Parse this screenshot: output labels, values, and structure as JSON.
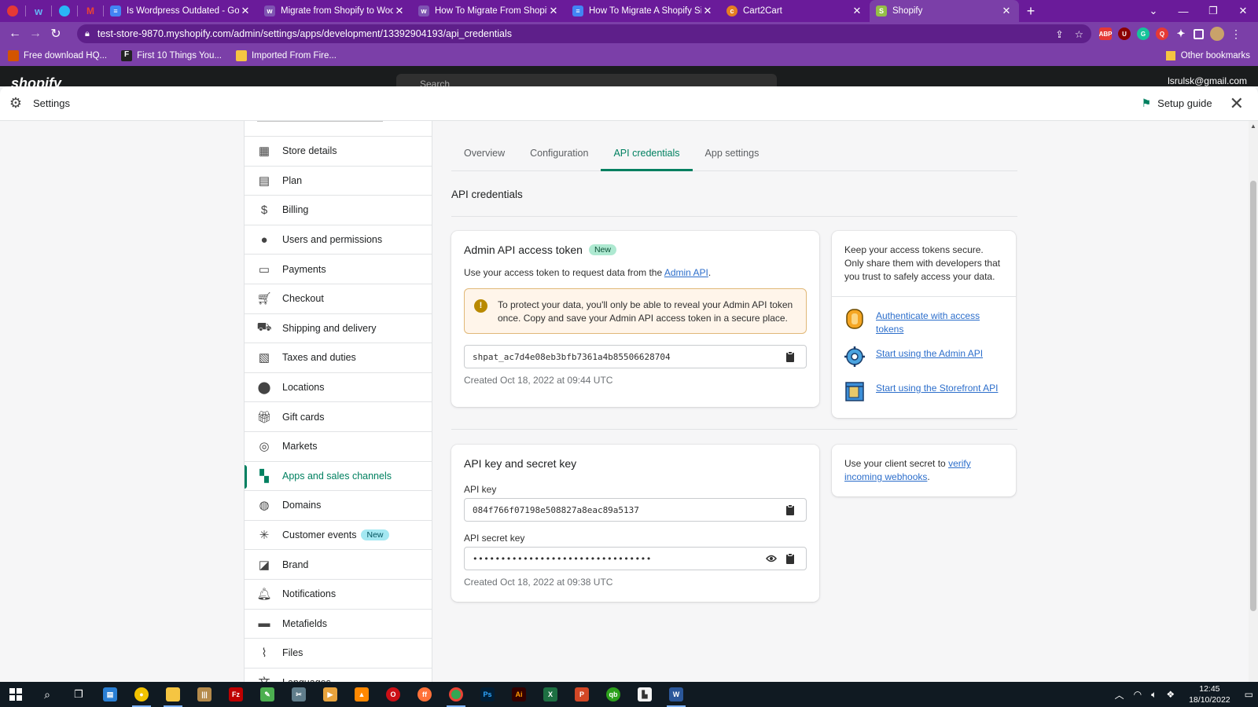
{
  "browser": {
    "tabs": [
      {
        "title": "",
        "icon": "search-icon",
        "color": "#e53935"
      },
      {
        "title": "",
        "icon": "wordpress-icon",
        "color": "#1e88e5"
      },
      {
        "title": "",
        "icon": "globe-icon",
        "color": "#29b6f6"
      },
      {
        "title": "",
        "icon": "gmail-icon",
        "color": "#ea4335"
      },
      {
        "title": "Is Wordpress Outdated - Google",
        "icon": "docs-icon",
        "color": "#4285f4"
      },
      {
        "title": "Migrate from Shopify to WooCon",
        "icon": "woo-icon",
        "color": "#7f54b3"
      },
      {
        "title": "How To Migrate From Shopify To",
        "icon": "woo-icon",
        "color": "#7f54b3"
      },
      {
        "title": "How To Migrate A Shopify Site To",
        "icon": "docs-icon",
        "color": "#4285f4"
      },
      {
        "title": "Cart2Cart",
        "icon": "cart2cart-icon",
        "color": "#e67e22"
      },
      {
        "title": "Shopify",
        "icon": "shopify-icon",
        "color": "#95bf47"
      }
    ],
    "url": "test-store-9870.myshopify.com/admin/settings/apps/development/13392904193/api_credentials",
    "bookmarks": [
      "Free download HQ...",
      "First 10 Things You...",
      "Imported From Fire..."
    ],
    "other_bookmarks": "Other bookmarks"
  },
  "admin": {
    "logo": "shopify",
    "search_placeholder": "Search",
    "account": "lsrulsk@gmail.com"
  },
  "settings": {
    "title": "Settings",
    "setup_guide": "Setup guide"
  },
  "sidebar": {
    "items": [
      {
        "label": "Store details",
        "icon": "store-icon"
      },
      {
        "label": "Plan",
        "icon": "plan-icon"
      },
      {
        "label": "Billing",
        "icon": "billing-icon"
      },
      {
        "label": "Users and permissions",
        "icon": "user-icon"
      },
      {
        "label": "Payments",
        "icon": "payments-icon"
      },
      {
        "label": "Checkout",
        "icon": "cart-icon"
      },
      {
        "label": "Shipping and delivery",
        "icon": "truck-icon"
      },
      {
        "label": "Taxes and duties",
        "icon": "taxes-icon"
      },
      {
        "label": "Locations",
        "icon": "location-pin-icon"
      },
      {
        "label": "Gift cards",
        "icon": "gift-icon"
      },
      {
        "label": "Markets",
        "icon": "markets-icon"
      },
      {
        "label": "Apps and sales channels",
        "icon": "apps-icon"
      },
      {
        "label": "Domains",
        "icon": "globe-icon"
      },
      {
        "label": "Customer events",
        "icon": "cursor-icon",
        "badge": "New"
      },
      {
        "label": "Brand",
        "icon": "brand-icon"
      },
      {
        "label": "Notifications",
        "icon": "bell-icon"
      },
      {
        "label": "Metafields",
        "icon": "metafields-icon"
      },
      {
        "label": "Files",
        "icon": "paperclip-icon"
      },
      {
        "label": "Languages",
        "icon": "language-icon"
      }
    ],
    "active_index": 11
  },
  "tabs": [
    "Overview",
    "Configuration",
    "API credentials",
    "App settings"
  ],
  "active_tab": 2,
  "page_heading": "API credentials",
  "admin_token_card": {
    "title": "Admin API access token",
    "badge": "New",
    "desc_prefix": "Use your access token to request data from the ",
    "desc_link": "Admin API",
    "desc_suffix": ".",
    "banner": "To protect your data, you'll only be able to reveal your Admin API token once. Copy and save your Admin API access token in a secure place.",
    "token": "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",
    "created": "Created Oct 18, 2022 at 09:44 UTC"
  },
  "security_card": {
    "text": "Keep your access tokens secure. Only share them with developers that you trust to safely access your data.",
    "resources": [
      {
        "label": "Authenticate with access tokens",
        "icon": "coin-icon"
      },
      {
        "label": "Start using the Admin API",
        "icon": "gear-icon"
      },
      {
        "label": "Start using the Storefront API",
        "icon": "storefront-icon"
      }
    ]
  },
  "api_key_card": {
    "title": "API key and secret key",
    "api_key_label": "API key",
    "api_key": "084f766f07198e508827a8eac89a5137",
    "secret_label": "API secret key",
    "secret": "••••••••••••••••••••••••••••••••",
    "created": "Created Oct 18, 2022 at 09:38 UTC"
  },
  "webhook_card": {
    "prefix": "Use your client secret to ",
    "link": "verify incoming webhooks",
    "suffix": "."
  },
  "taskbar": {
    "time": "12:45",
    "date": "18/10/2022"
  },
  "colors": {
    "accent": "#008060",
    "browser": "#7b3fa8",
    "link": "#2c6ecb"
  }
}
